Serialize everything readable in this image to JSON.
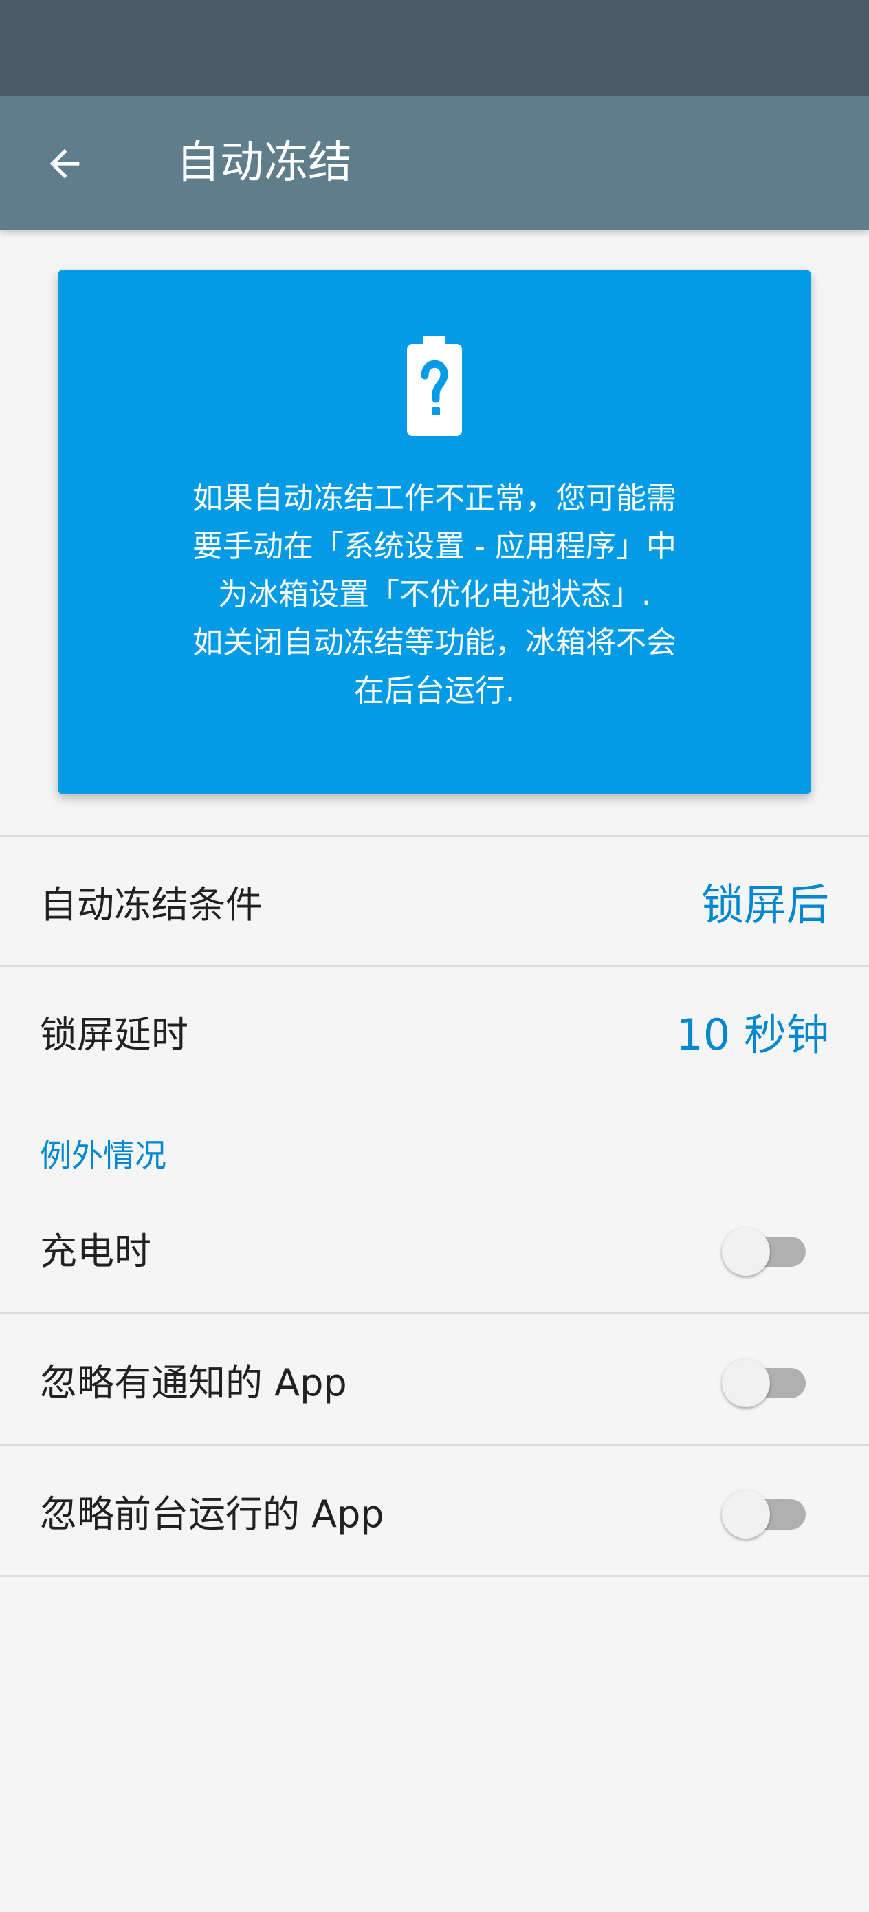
{
  "header": {
    "title": "自动冻结",
    "back_icon": "arrow-left-icon"
  },
  "info_card": {
    "icon": "battery-unknown-icon",
    "text": "如果自动冻结工作不正常，您可能需\n要手动在「系统设置 - 应用程序」中\n为冰箱设置「不优化电池状态」.\n如关闭自动冻结等功能，冰箱将不会\n在后台运行.",
    "background_color": "#039be5"
  },
  "settings": {
    "freeze_condition": {
      "label": "自动冻结条件",
      "value": "锁屏后"
    },
    "lock_delay": {
      "label": "锁屏延时",
      "value": "10 秒钟"
    }
  },
  "exceptions": {
    "header": "例外情况",
    "items": [
      {
        "label": "充电时",
        "enabled": false
      },
      {
        "label": "忽略有通知的 App",
        "enabled": false
      },
      {
        "label": "忽略前台运行的 App",
        "enabled": false
      }
    ]
  },
  "colors": {
    "status_bar": "#4a5b66",
    "app_bar": "#607d8b",
    "accent": "#0288d1",
    "background": "#f5f5f5"
  }
}
